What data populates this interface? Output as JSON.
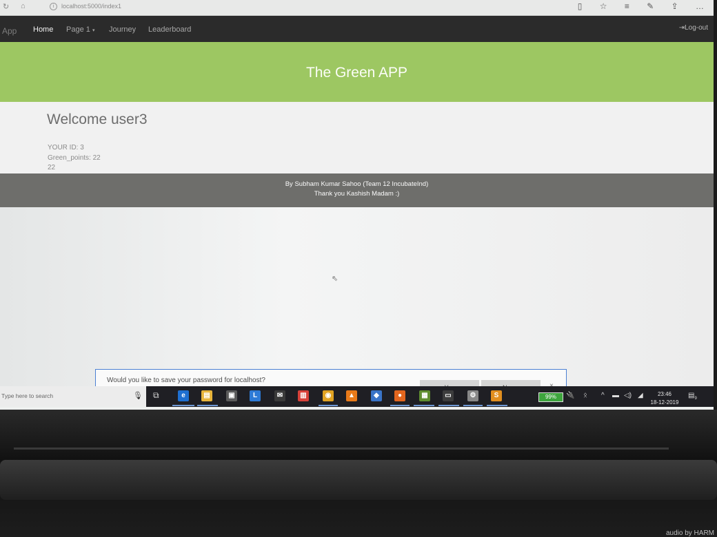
{
  "browser": {
    "url": "localhost:5000/index1",
    "toolbar_icons": [
      "reading-view-icon",
      "favorite-star-icon",
      "favorites-list-icon",
      "pen-icon",
      "share-icon",
      "more-icon"
    ]
  },
  "nav": {
    "brand": "App",
    "links": [
      "Home",
      "Page 1",
      "Journey",
      "Leaderboard"
    ],
    "active": "Home",
    "logout": "Log-out"
  },
  "banner": {
    "title": "The Green APP"
  },
  "content": {
    "welcome": "Welcome user3",
    "your_id": "YOUR ID: 3",
    "green_points": "Green_points: 22",
    "extra": "22"
  },
  "footer": {
    "line1": "By Subham Kumar Sahoo (Team 12 IncubateInd)",
    "line2": "Thank you Kashish Madam :)"
  },
  "password_prompt": {
    "question": "Would you like to save your password for localhost?",
    "yes": "Yes",
    "never": "Never",
    "close": "×"
  },
  "taskbar": {
    "search_placeholder": "Type here to search",
    "battery": "99%",
    "time": "23:46",
    "date": "18-12-2019",
    "notifications": "9"
  },
  "laptop": {
    "brand_text": "audio by HARM"
  },
  "colors": {
    "banner": "#9dc762",
    "navbar": "#2b2b2b",
    "footer": "#6e6e6b",
    "prompt_border": "#4a7fd3"
  }
}
